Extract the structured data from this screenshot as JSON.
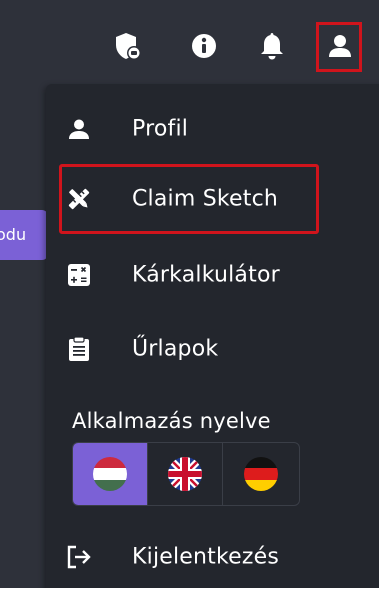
{
  "topbar": {
    "icons": [
      "shield-icon",
      "info-icon",
      "bell-icon",
      "user-icon"
    ]
  },
  "partial_button": {
    "label": "odu"
  },
  "menu": {
    "items": [
      {
        "label": "Profil",
        "icon": "user-icon"
      },
      {
        "label": "Claim Sketch",
        "icon": "sketch-tools-icon"
      },
      {
        "label": "Kárkalkulátor",
        "icon": "calculator-icon"
      },
      {
        "label": "Űrlapok",
        "icon": "clipboard-icon"
      }
    ],
    "language_title": "Alkalmazás nyelve",
    "languages": [
      {
        "code": "hu",
        "flag": "hungary-flag",
        "active": true
      },
      {
        "code": "en",
        "flag": "uk-flag",
        "active": false
      },
      {
        "code": "de",
        "flag": "germany-flag",
        "active": false
      }
    ],
    "logout_label": "Kijelentkezés"
  },
  "colors": {
    "background": "#2e313a",
    "menu_background": "#23262d",
    "accent": "#7b61d6",
    "highlight": "#d0141c"
  }
}
